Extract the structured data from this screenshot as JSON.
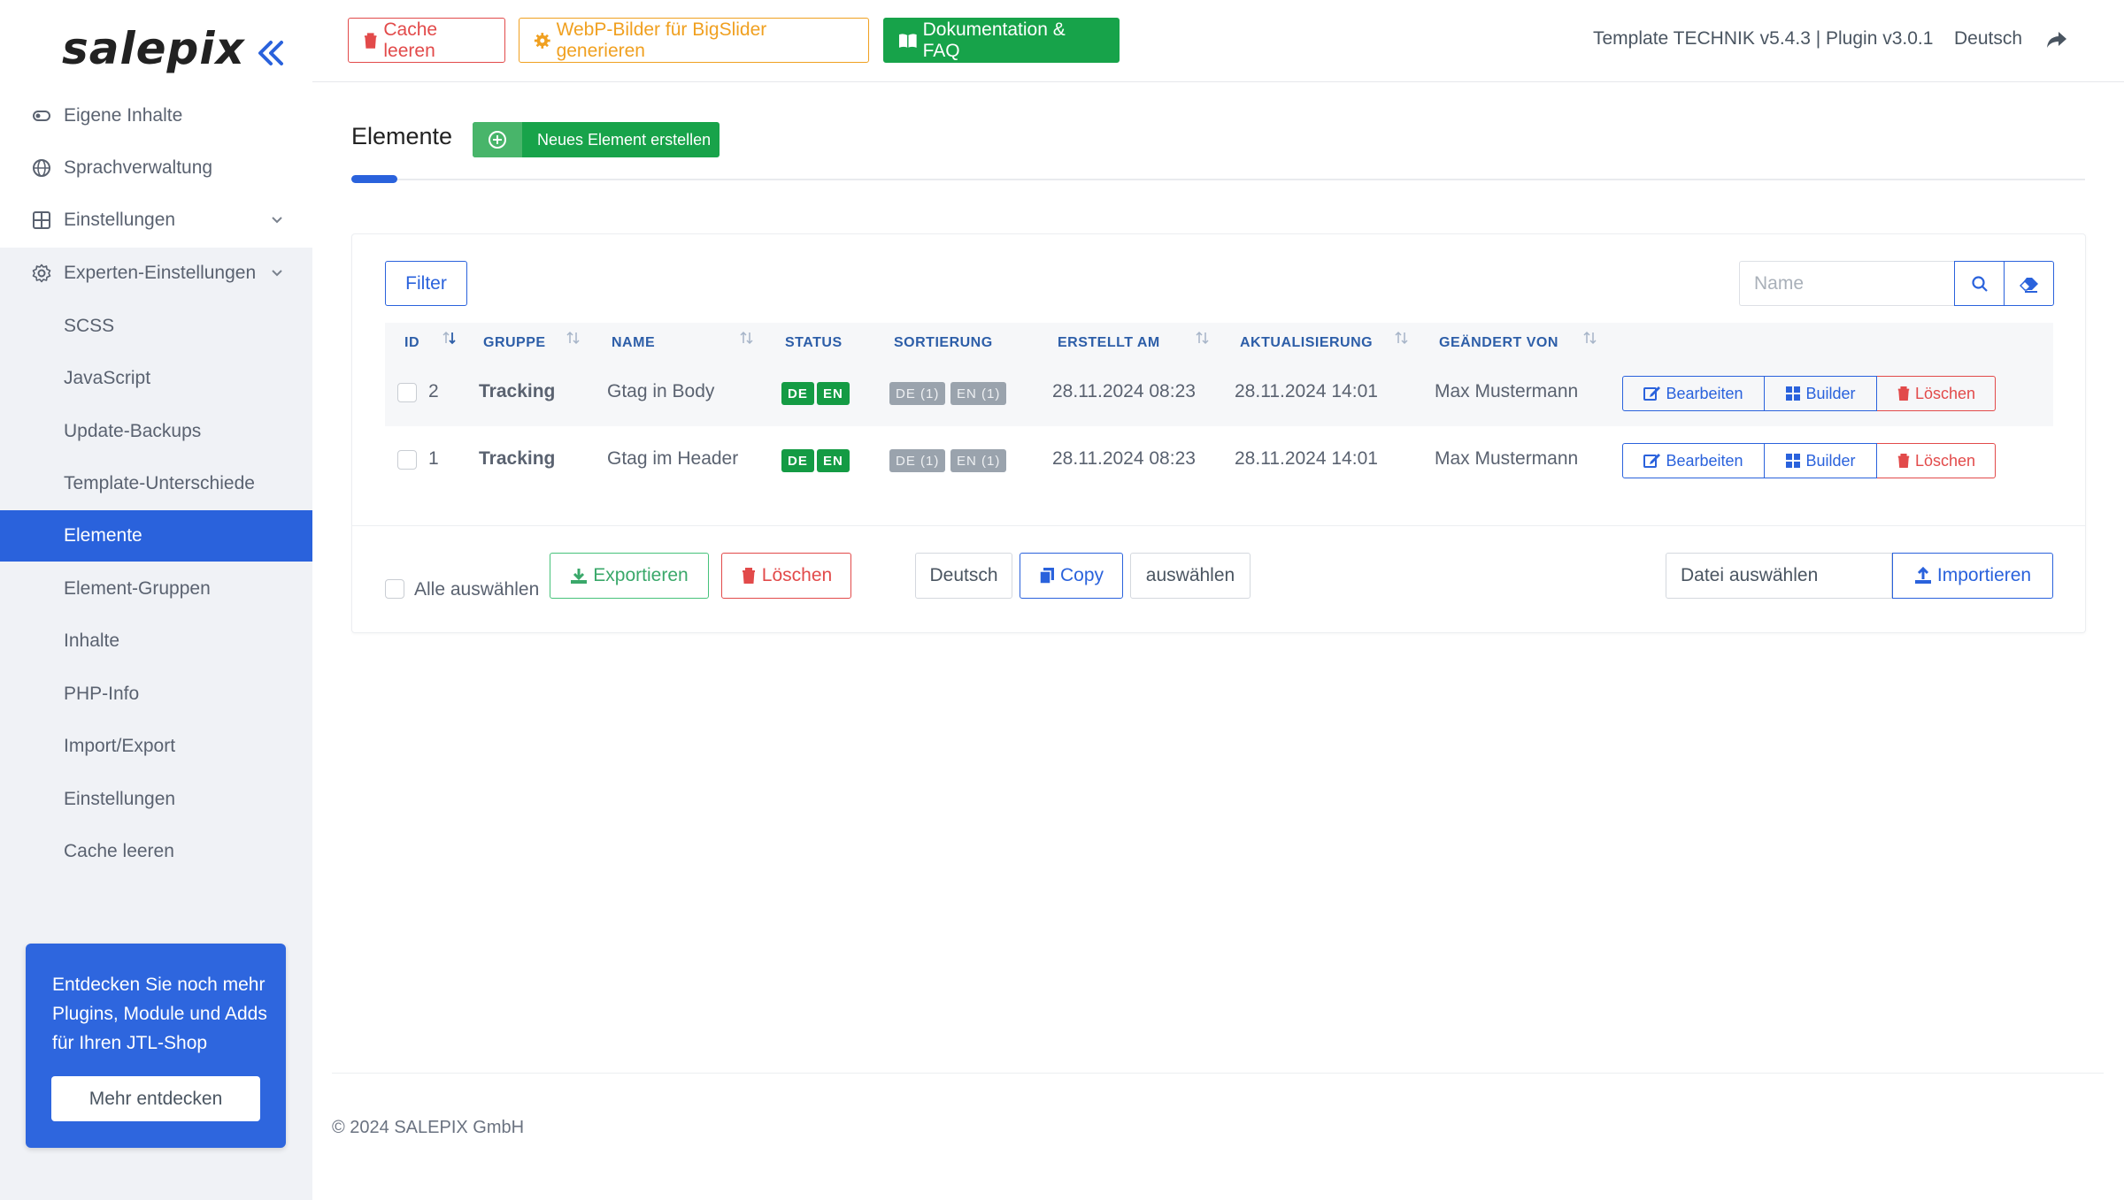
{
  "brand": {
    "logo": "salepix"
  },
  "sidebar": {
    "items": [
      {
        "label": "Eigene Inhalte",
        "icon": "toggle-icon"
      },
      {
        "label": "Sprachverwaltung",
        "icon": "globe-icon"
      },
      {
        "label": "Einstellungen",
        "icon": "grid-icon"
      },
      {
        "label": "Experten-Einstellungen",
        "icon": "gear-icon"
      }
    ],
    "subitems": [
      {
        "label": "SCSS"
      },
      {
        "label": "JavaScript"
      },
      {
        "label": "Update-Backups"
      },
      {
        "label": "Template-Unterschiede"
      },
      {
        "label": "Elemente",
        "active": true
      },
      {
        "label": "Element-Gruppen"
      },
      {
        "label": "Inhalte"
      },
      {
        "label": "PHP-Info"
      },
      {
        "label": "Import/Export"
      },
      {
        "label": "Einstellungen"
      },
      {
        "label": "Cache leeren"
      }
    ],
    "promo": {
      "text": "Entdecken Sie noch mehr Plugins, Module und Adds für Ihren JTL-Shop",
      "button": "Mehr entdecken"
    }
  },
  "topbar": {
    "cache_btn": "Cache leeren",
    "webp_btn": "WebP-Bilder für BigSlider generieren",
    "docs_btn": "Dokumentation & FAQ",
    "version": "Template TECHNIK v5.4.3 | Plugin v3.0.1",
    "language": "Deutsch"
  },
  "page": {
    "title": "Elemente",
    "new_button": "Neues Element erstellen"
  },
  "toolbar": {
    "filter": "Filter",
    "search_placeholder": "Name"
  },
  "table": {
    "columns": {
      "id": "ID",
      "group": "GRUPPE",
      "name": "NAME",
      "status": "STATUS",
      "sort": "SORTIERUNG",
      "created": "ERSTELLT AM",
      "updated": "AKTUALISIERUNG",
      "changed_by": "GEÄNDERT VON"
    },
    "rows": [
      {
        "id": "2",
        "group": "Tracking",
        "name": "Gtag in Body",
        "status": [
          "DE",
          "EN"
        ],
        "sort": [
          "DE (1)",
          "EN (1)"
        ],
        "created": "28.11.2024 08:23",
        "updated": "28.11.2024 14:01",
        "changed_by": "Max Mustermann"
      },
      {
        "id": "1",
        "group": "Tracking",
        "name": "Gtag im Header",
        "status": [
          "DE",
          "EN"
        ],
        "sort": [
          "DE (1)",
          "EN (1)"
        ],
        "created": "28.11.2024 08:23",
        "updated": "28.11.2024 14:01",
        "changed_by": "Max Mustermann"
      }
    ],
    "actions": {
      "edit": "Bearbeiten",
      "builder": "Builder",
      "delete": "Löschen"
    }
  },
  "footer_actions": {
    "select_all": "Alle auswählen",
    "export": "Exportieren",
    "delete": "Löschen",
    "lang": "Deutsch",
    "copy": "Copy",
    "pick": "auswählen",
    "file": "Datei auswählen",
    "import": "Importieren"
  },
  "footer": {
    "copyright": "© 2024 SALEPIX GmbH"
  },
  "colors": {
    "primary": "#2a62dc",
    "success": "#17a34a",
    "danger": "#e24a4a",
    "warning": "#f0a020"
  }
}
